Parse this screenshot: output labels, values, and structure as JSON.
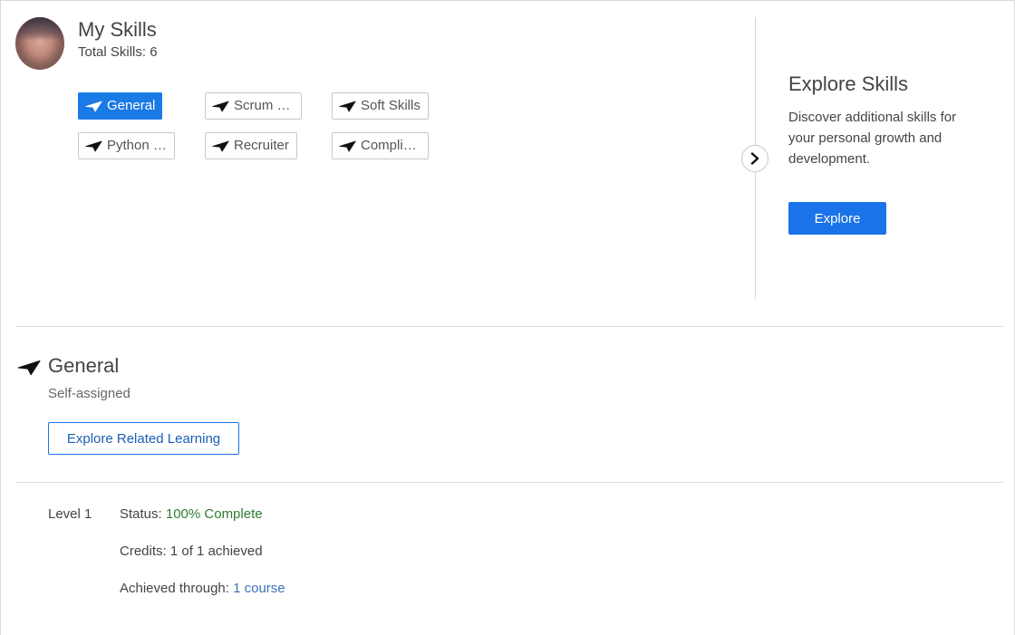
{
  "header": {
    "title": "My Skills",
    "total_label": "Total Skills: 6"
  },
  "skills": [
    {
      "label": "General",
      "active": true
    },
    {
      "label": "Scrum Master",
      "active": false
    },
    {
      "label": "Soft Skills",
      "active": false
    },
    {
      "label": "Python Developer",
      "active": false
    },
    {
      "label": "Recruiter",
      "active": false
    },
    {
      "label": "Compliance",
      "active": false
    }
  ],
  "explore": {
    "title": "Explore Skills",
    "description": "Discover additional skills for your personal growth and development.",
    "button_label": "Explore"
  },
  "detail": {
    "title": "General",
    "subtitle": "Self-assigned",
    "related_button": "Explore Related Learning",
    "level": "Level 1",
    "status_label": "Status: ",
    "status_value": "100% Complete",
    "credits": "Credits: 1 of 1 achieved",
    "achieved_label": "Achieved through: ",
    "achieved_link": "1 course"
  },
  "colors": {
    "accent": "#1a73e8",
    "status_complete": "#2e7d32",
    "link": "#3b73b9"
  },
  "icons": {
    "skill": "paper-plane-icon",
    "carousel": "chevron-right-icon"
  }
}
